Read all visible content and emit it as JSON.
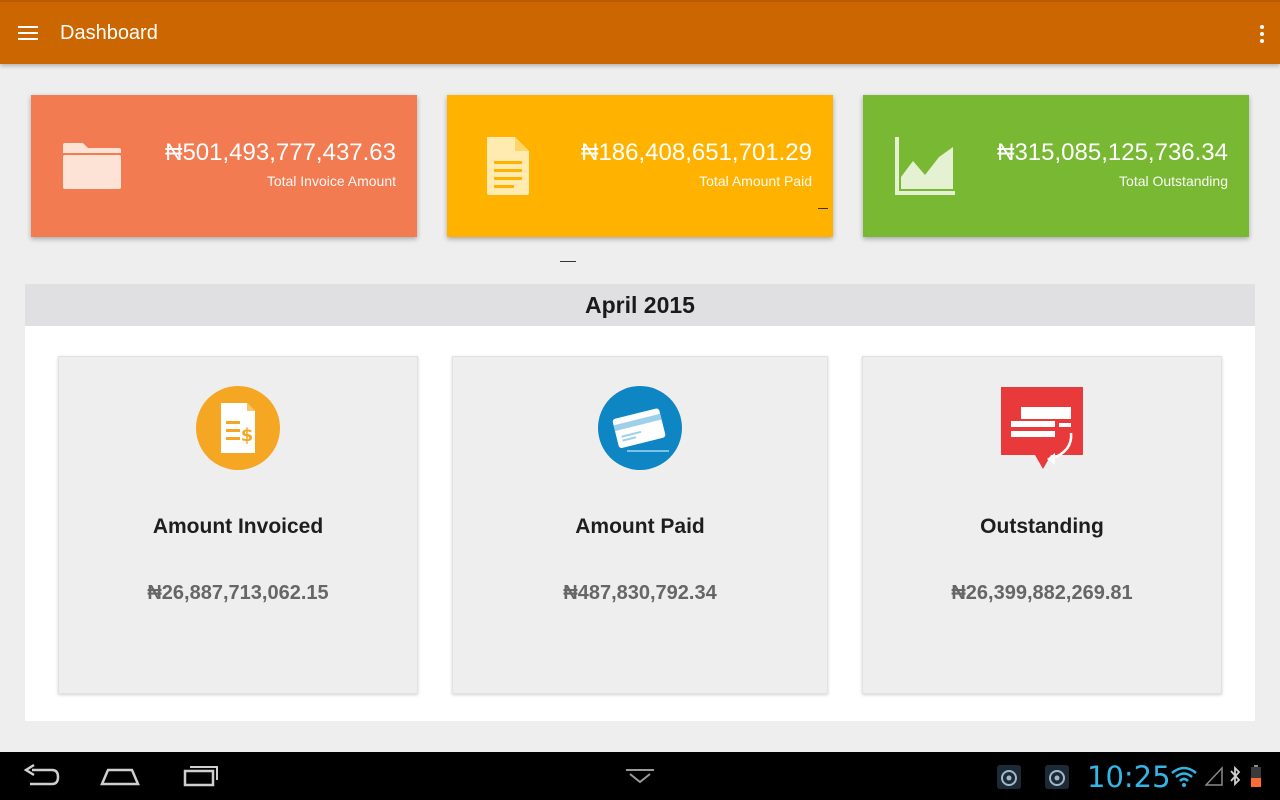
{
  "app_bar": {
    "title": "Dashboard",
    "background": "#cc6600"
  },
  "summary_cards": [
    {
      "amount": "₦501,493,777,437.63",
      "label": "Total Invoice Amount",
      "color": "#f27b52",
      "icon": "folder-icon"
    },
    {
      "amount": "₦186,408,651,701.29",
      "label": "Total Amount Paid",
      "color": "#ffb300",
      "icon": "document-icon"
    },
    {
      "amount": "₦315,085,125,736.34",
      "label": "Total Outstanding",
      "color": "#78b833",
      "icon": "area-chart-icon"
    }
  ],
  "period": {
    "title": "April 2015",
    "cards": [
      {
        "title": "Amount Invoiced",
        "value": "₦26,887,713,062.15",
        "icon": "invoice-dollar-icon",
        "icon_color": "#f5a623"
      },
      {
        "title": "Amount Paid",
        "value": "₦487,830,792.34",
        "icon": "credit-card-icon",
        "icon_color": "#0e86c4"
      },
      {
        "title": "Outstanding",
        "value": "₦26,399,882,269.81",
        "icon": "outstanding-cards-icon",
        "icon_color": "#e83a3a"
      }
    ]
  },
  "system_bar": {
    "time": "10:25",
    "clock_color": "#33b5e5"
  }
}
